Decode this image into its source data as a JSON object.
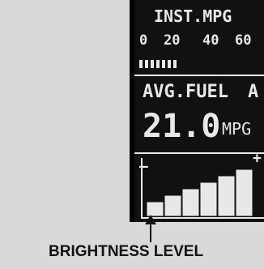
{
  "display": {
    "inst_label": "INST.MPG",
    "scale": [
      "0",
      "20",
      "40",
      "60"
    ],
    "avg_label": "AVG.FUEL",
    "avg_mode": "A",
    "value": "21.0",
    "unit": "MPG",
    "minus": "–",
    "plus": "+",
    "brightness_level": 6,
    "brightness_max": 6
  },
  "caption": "BRIGHTNESS LEVEL",
  "colors": {
    "lcd_bg": "#111111",
    "lcd_fg": "#e8e8e8",
    "page_bg": "#d9d9d9"
  }
}
